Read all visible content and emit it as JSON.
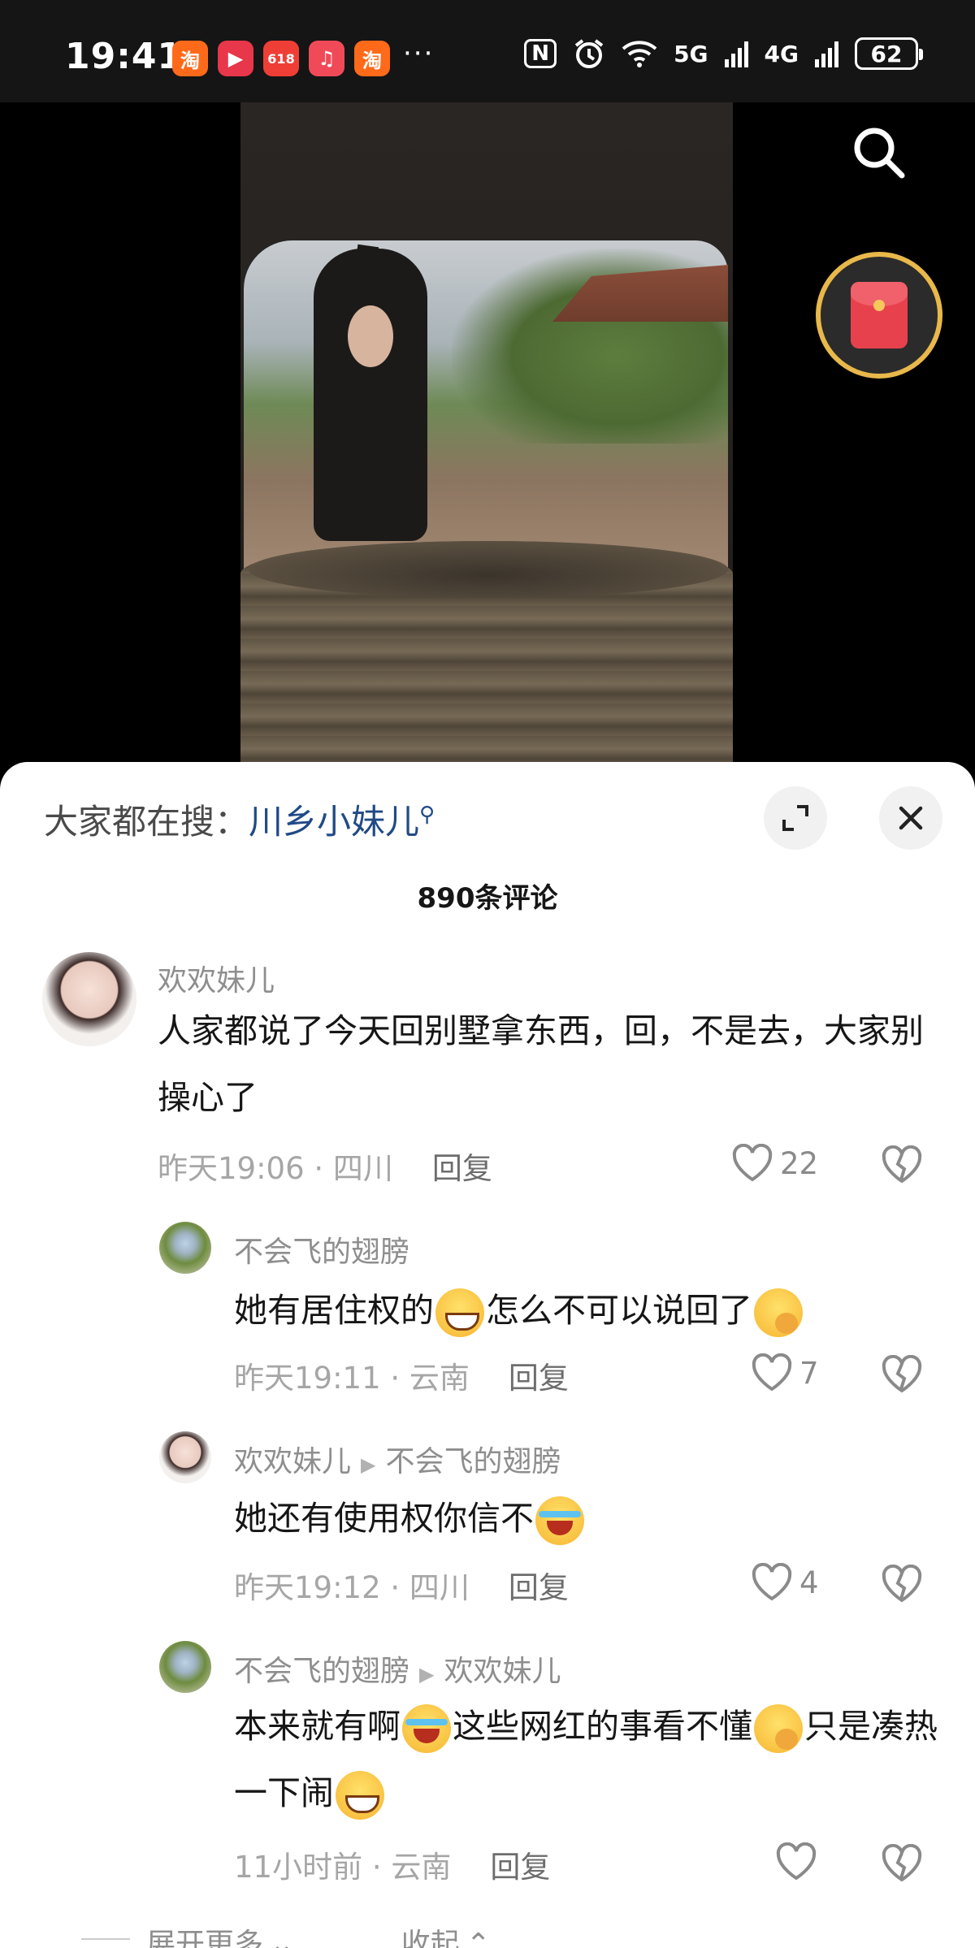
{
  "status_bar": {
    "time": "19:41",
    "apps": [
      {
        "icon": "taobao-icon",
        "label": "淘",
        "color": "#ff6a1a"
      },
      {
        "icon": "video-app-icon",
        "label": "▶",
        "color": "#e8364a"
      },
      {
        "icon": "promo-app-icon",
        "label": "618",
        "color": "#ef3e36"
      },
      {
        "icon": "music-app-icon",
        "label": "♫",
        "color": "#f04a58"
      },
      {
        "icon": "taobao-icon",
        "label": "淘",
        "color": "#ff6a1a"
      }
    ],
    "more": "···",
    "nfc": "N",
    "net1": "5G",
    "net2": "4G",
    "battery": "62"
  },
  "panel": {
    "trend_prefix": "大家都在搜：",
    "trend_query": "川乡小妹儿",
    "comment_count": "890条评论",
    "comments": [
      {
        "user": "欢欢妹儿",
        "text": "人家都说了今天回别墅拿东西，回，不是去，大家别操心了",
        "time_place": "昨天19:06 · 四川",
        "reply": "回复",
        "likes": "22"
      },
      {
        "user": "不会飞的翅膀",
        "text_a": "她有居住权的",
        "text_b": "怎么不可以说回了",
        "time_place": "昨天19:11 · 云南",
        "reply": "回复",
        "likes": "7"
      },
      {
        "user": "欢欢妹儿",
        "to_user": "不会飞的翅膀",
        "text_a": "她还有使用权你信不",
        "time_place": "昨天19:12 · 四川",
        "reply": "回复",
        "likes": "4"
      },
      {
        "user": "不会飞的翅膀",
        "to_user": "欢欢妹儿",
        "text_a": "本来就有啊",
        "text_b": "这些网红的事看不懂",
        "text_c": "只是凑热一下闹",
        "time_place": "11小时前 · 云南",
        "reply": "回复",
        "likes": ""
      }
    ],
    "expand_more": "展开更多",
    "collapse": "收起"
  }
}
